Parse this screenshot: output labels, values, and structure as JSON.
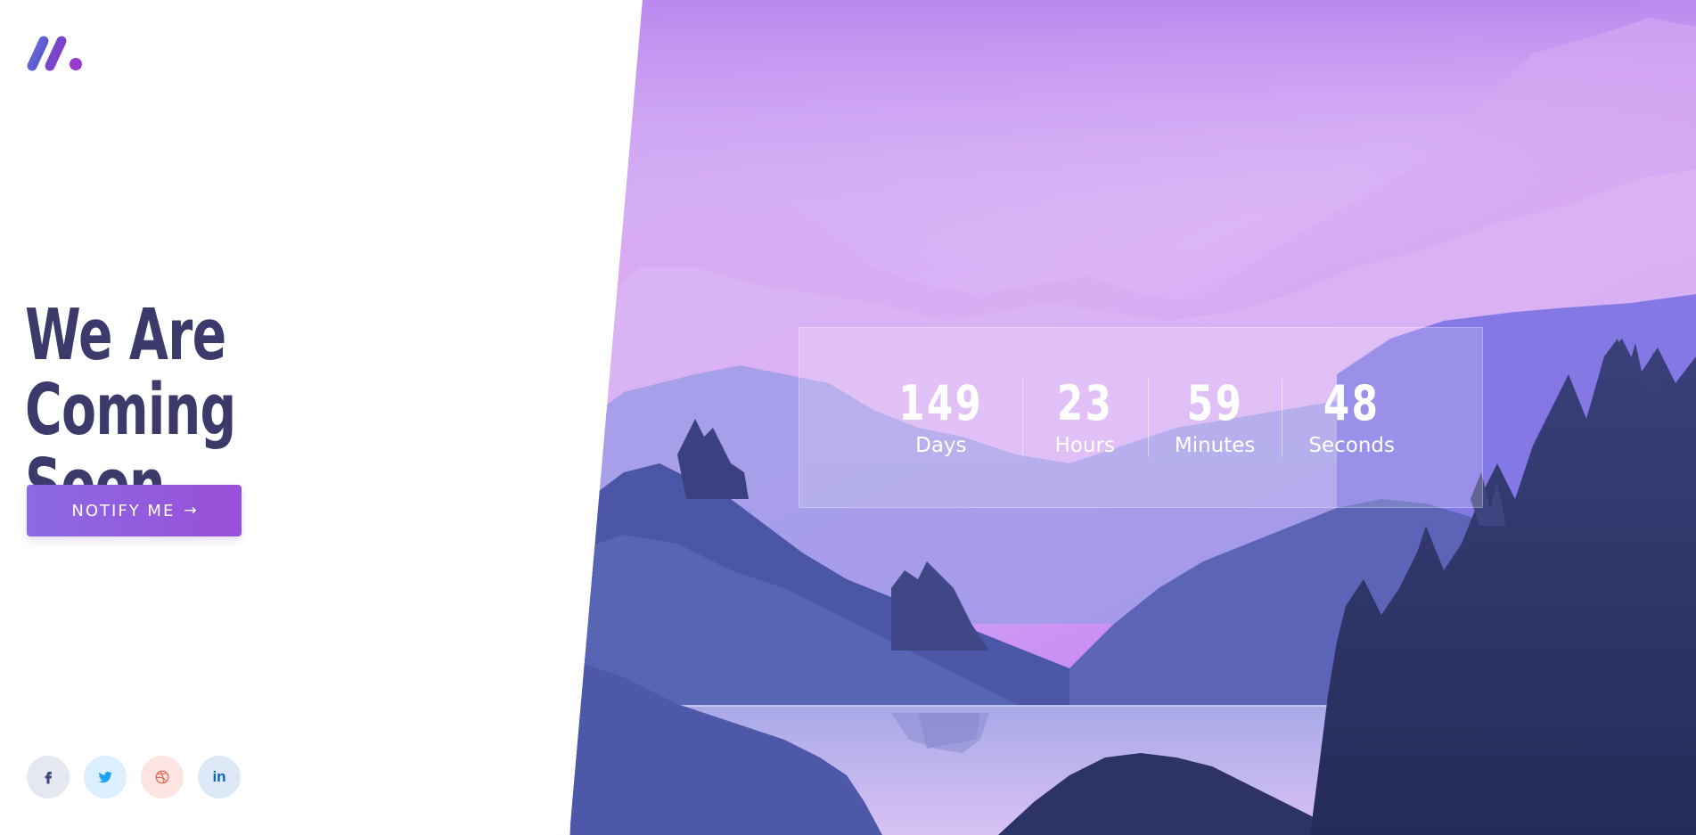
{
  "brand": {
    "logo_icon": "brand-slashes-logo",
    "colors": {
      "logo_start": "#5b5fc7",
      "logo_end": "#9b3fd1"
    }
  },
  "hero": {
    "headline_line1": "We Are Coming",
    "headline_line2": "Soon",
    "cta_label": "NOTIFY ME",
    "cta_icon": "arrow-right-icon",
    "colors": {
      "headline": "#3b3a6b",
      "cta_start": "#8b6ae3",
      "cta_end": "#9a4fd9"
    }
  },
  "countdown": {
    "units": [
      {
        "value": "149",
        "label": "Days"
      },
      {
        "value": "23",
        "label": "Hours"
      },
      {
        "value": "59",
        "label": "Minutes"
      },
      {
        "value": "48",
        "label": "Seconds"
      }
    ]
  },
  "socials": [
    {
      "icon": "facebook-icon",
      "color": "#3b4a7c"
    },
    {
      "icon": "twitter-icon",
      "color": "#1da1f2"
    },
    {
      "icon": "dribbble-icon",
      "color": "#ea6b5b"
    },
    {
      "icon": "linkedin-icon",
      "color": "#0a66c2",
      "text": "in"
    }
  ]
}
